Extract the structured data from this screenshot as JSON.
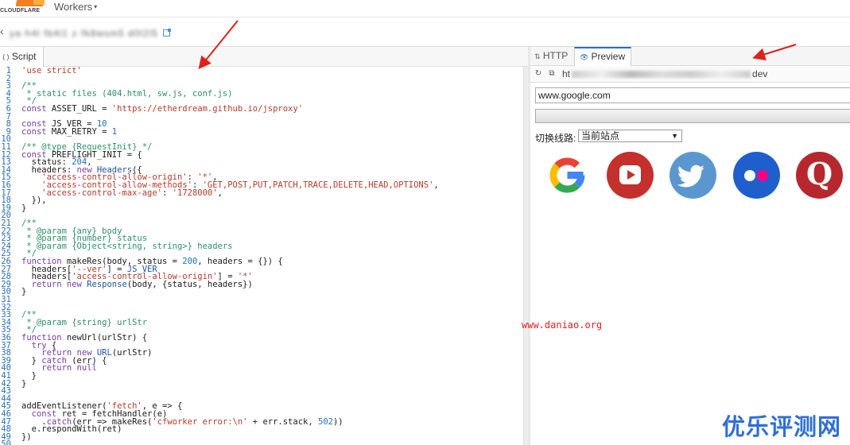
{
  "header": {
    "logo_text": "CLOUDFLARE",
    "product_menu": "Workers",
    "caret": "▾"
  },
  "worker": {
    "name": "ya·h4l fb4l1 z·fk8wsm5 d0l2l5",
    "back_glyph": "‹"
  },
  "editor": {
    "tab_icon": "⟨⟩",
    "tab_label": "Script",
    "lines": [
      [
        [
          "s",
          "'use strict'"
        ]
      ],
      [
        [
          "",
          ""
        ]
      ],
      [
        [
          "c",
          "/**"
        ]
      ],
      [
        [
          "c",
          " * static files (404.html, sw.js, conf.js)"
        ]
      ],
      [
        [
          "c",
          " */"
        ]
      ],
      [
        [
          "k",
          "const"
        ],
        [
          "",
          " ASSET_URL = "
        ],
        [
          "s",
          "'https://etherdream.github.io/jsproxy'"
        ]
      ],
      [
        [
          "",
          ""
        ]
      ],
      [
        [
          "k",
          "const"
        ],
        [
          "",
          " JS_VER = "
        ],
        [
          "n",
          "10"
        ]
      ],
      [
        [
          "k",
          "const"
        ],
        [
          "",
          " MAX_RETRY = "
        ],
        [
          "n",
          "1"
        ]
      ],
      [
        [
          "",
          ""
        ]
      ],
      [
        [
          "c",
          "/** @type {RequestInit} */"
        ]
      ],
      [
        [
          "k",
          "const"
        ],
        [
          "",
          " PREFLIGHT_INIT = {"
        ]
      ],
      [
        [
          "",
          "  status: "
        ],
        [
          "n",
          "204"
        ],
        [
          "",
          ","
        ]
      ],
      [
        [
          "",
          "  headers: "
        ],
        [
          "k",
          "new"
        ],
        [
          "",
          " "
        ],
        [
          "d",
          "Headers"
        ],
        [
          "",
          "({"
        ]
      ],
      [
        [
          "s",
          "    'access-control-allow-origin'"
        ],
        [
          "",
          ": "
        ],
        [
          "s",
          "'*'"
        ],
        [
          "",
          ","
        ]
      ],
      [
        [
          "s",
          "    'access-control-allow-methods'"
        ],
        [
          "",
          ": "
        ],
        [
          "s",
          "'GET,POST,PUT,PATCH,TRACE,DELETE,HEAD,OPTIONS'"
        ],
        [
          "",
          ","
        ]
      ],
      [
        [
          "s",
          "    'access-control-max-age'"
        ],
        [
          "",
          ": "
        ],
        [
          "s",
          "'1728000'"
        ],
        [
          "",
          ","
        ]
      ],
      [
        [
          "",
          "  }),"
        ]
      ],
      [
        [
          "",
          "}"
        ]
      ],
      [
        [
          "",
          ""
        ]
      ],
      [
        [
          "c",
          "/**"
        ]
      ],
      [
        [
          "c",
          " * @param {any} body"
        ]
      ],
      [
        [
          "c",
          " * @param {number} status"
        ]
      ],
      [
        [
          "c",
          " * @param {Object<string, string>} headers"
        ]
      ],
      [
        [
          "c",
          " */"
        ]
      ],
      [
        [
          "k",
          "function"
        ],
        [
          "",
          " makeRes(body, status = "
        ],
        [
          "n",
          "200"
        ],
        [
          "",
          ", headers = {}) {"
        ]
      ],
      [
        [
          "",
          "  headers["
        ],
        [
          "s",
          "'--ver'"
        ],
        [
          "",
          "] = "
        ],
        [
          "d",
          "JS_VER"
        ]
      ],
      [
        [
          "",
          "  headers["
        ],
        [
          "s",
          "'access-control-allow-origin'"
        ],
        [
          "",
          "] = "
        ],
        [
          "s",
          "'*'"
        ]
      ],
      [
        [
          "k",
          "  return"
        ],
        [
          "",
          " "
        ],
        [
          "k",
          "new"
        ],
        [
          "",
          " "
        ],
        [
          "d",
          "Response"
        ],
        [
          "",
          "(body, {status, headers})"
        ]
      ],
      [
        [
          "",
          "}"
        ]
      ],
      [
        [
          "",
          ""
        ]
      ],
      [
        [
          "",
          ""
        ]
      ],
      [
        [
          "c",
          "/**"
        ]
      ],
      [
        [
          "c",
          " * @param {string} urlStr"
        ]
      ],
      [
        [
          "c",
          " */"
        ]
      ],
      [
        [
          "k",
          "function"
        ],
        [
          "",
          " newUrl(urlStr) {"
        ]
      ],
      [
        [
          "k",
          "  try"
        ],
        [
          "",
          " {"
        ]
      ],
      [
        [
          "k",
          "    return"
        ],
        [
          "",
          " "
        ],
        [
          "k",
          "new"
        ],
        [
          "",
          " "
        ],
        [
          "d",
          "URL"
        ],
        [
          "",
          "(urlStr)"
        ]
      ],
      [
        [
          "",
          "  } "
        ],
        [
          "k",
          "catch"
        ],
        [
          "",
          " (err) {"
        ]
      ],
      [
        [
          "k",
          "    return"
        ],
        [
          "",
          " "
        ],
        [
          "k",
          "null"
        ]
      ],
      [
        [
          "",
          "  }"
        ]
      ],
      [
        [
          "",
          "}"
        ]
      ],
      [
        [
          "",
          ""
        ]
      ],
      [
        [
          "",
          ""
        ]
      ],
      [
        [
          "",
          "addEventListener("
        ],
        [
          "s",
          "'fetch'"
        ],
        [
          "",
          ", e => {"
        ]
      ],
      [
        [
          "k",
          "  const"
        ],
        [
          "",
          " ret = fetchHandler(e)"
        ]
      ],
      [
        [
          "",
          "    ."
        ],
        [
          "k",
          "catch"
        ],
        [
          "",
          "(err => makeRes("
        ],
        [
          "s",
          "'cfworker error:\\n'"
        ],
        [
          "",
          " + err.stack, "
        ],
        [
          "n",
          "502"
        ],
        [
          "",
          "))"
        ]
      ],
      [
        [
          "",
          "  e.respondWith(ret)"
        ]
      ],
      [
        [
          "",
          "})"
        ]
      ],
      [
        [
          "",
          ""
        ]
      ]
    ]
  },
  "preview_panel": {
    "tab_http_icon": "⇅",
    "tab_http": "HTTP",
    "tab_preview_icon": "👁",
    "tab_preview": "Preview",
    "refresh_icon": "↻",
    "open_icon": "⧉",
    "url_start": "ht",
    "url_end": "dev",
    "url_input_value": "www.google.com",
    "line_label": "切换线路:",
    "line_select_value": "当前站点",
    "select_arrow": "▼",
    "sites": [
      "google",
      "youtube",
      "twitter",
      "flickr",
      "quora"
    ],
    "twitter_glyph": "🐦",
    "quora_letter": "Q"
  },
  "watermarks": {
    "site_url": "www.daniao.org",
    "brand": "优乐评测网"
  },
  "colors": {
    "accent": "#2a6fbd",
    "annotation_arrow": "#e0201a",
    "cloudflare_orange": "#f38020"
  }
}
